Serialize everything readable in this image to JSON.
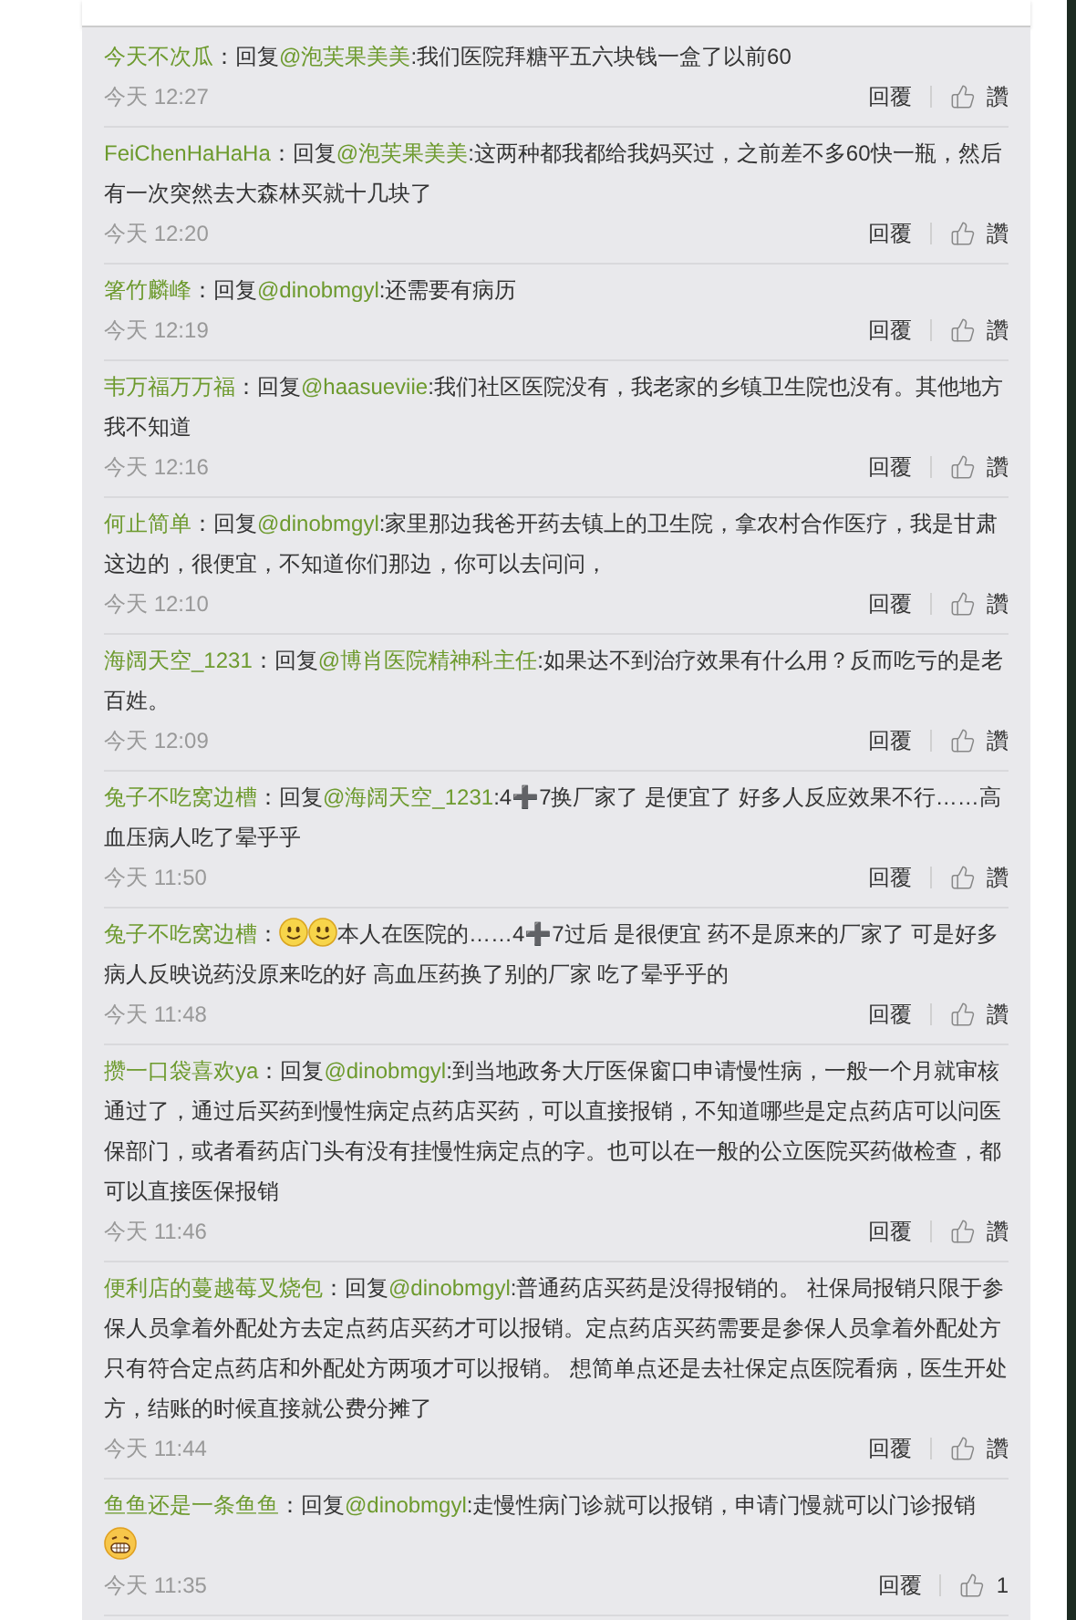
{
  "comments": [
    {
      "user": "今天不次瓜",
      "separator": "：",
      "parts": [
        {
          "kind": "text",
          "text": "回复"
        },
        {
          "kind": "mention",
          "text": "@泡芙果美美"
        },
        {
          "kind": "text",
          "text": ":我们医院拜糖平五六块钱一盒了以前60"
        }
      ],
      "time": "今天 12:27",
      "reply": "回覆",
      "like": "讚"
    },
    {
      "user": "FeiChenHaHaHa",
      "separator": "：",
      "parts": [
        {
          "kind": "text",
          "text": "回复"
        },
        {
          "kind": "mention",
          "text": "@泡芙果美美"
        },
        {
          "kind": "text",
          "text": ":这两种都我都给我妈买过，之前差不多60快一瓶，然后有一次突然去大森林买就十几块了"
        }
      ],
      "time": "今天 12:20",
      "reply": "回覆",
      "like": "讚"
    },
    {
      "user": "箸竹麟峰",
      "separator": "：",
      "parts": [
        {
          "kind": "text",
          "text": "回复"
        },
        {
          "kind": "mention",
          "text": "@dinobmgyl"
        },
        {
          "kind": "text",
          "text": ":还需要有病历"
        }
      ],
      "time": "今天 12:19",
      "reply": "回覆",
      "like": "讚"
    },
    {
      "user": "韦万福万万福",
      "separator": "：",
      "parts": [
        {
          "kind": "text",
          "text": "回复"
        },
        {
          "kind": "mention",
          "text": "@haasueviie"
        },
        {
          "kind": "text",
          "text": ":我们社区医院没有，我老家的乡镇卫生院也没有。其他地方我不知道"
        }
      ],
      "time": "今天 12:16",
      "reply": "回覆",
      "like": "讚"
    },
    {
      "user": "何止简单",
      "separator": "：",
      "parts": [
        {
          "kind": "text",
          "text": "回复"
        },
        {
          "kind": "mention",
          "text": "@dinobmgyl"
        },
        {
          "kind": "text",
          "text": ":家里那边我爸开药去镇上的卫生院，拿农村合作医疗，我是甘肃这边的，很便宜，不知道你们那边，你可以去问问，"
        }
      ],
      "time": "今天 12:10",
      "reply": "回覆",
      "like": "讚"
    },
    {
      "user": "海阔天空_1231",
      "separator": "：",
      "parts": [
        {
          "kind": "text",
          "text": "回复"
        },
        {
          "kind": "mention",
          "text": "@博肖医院精神科主任"
        },
        {
          "kind": "text",
          "text": ":如果达不到治疗效果有什么用？反而吃亏的是老百姓。"
        }
      ],
      "time": "今天 12:09",
      "reply": "回覆",
      "like": "讚"
    },
    {
      "user": "兔子不吃窝边槽",
      "separator": "：",
      "parts": [
        {
          "kind": "text",
          "text": "回复"
        },
        {
          "kind": "mention",
          "text": "@海阔天空_1231"
        },
        {
          "kind": "text",
          "text": ":4➕7换厂家了 是便宜了 好多人反应效果不行……高血压病人吃了晕乎乎"
        }
      ],
      "time": "今天 11:50",
      "reply": "回覆",
      "like": "讚"
    },
    {
      "user": "兔子不吃窝边槽",
      "separator": "：",
      "parts": [
        {
          "kind": "smile"
        },
        {
          "kind": "smile"
        },
        {
          "kind": "text",
          "text": "本人在医院的……4➕7过后 是很便宜 药不是原来的厂家了 可是好多病人反映说药没原来吃的好 高血压药换了别的厂家 吃了晕乎乎的"
        }
      ],
      "time": "今天 11:48",
      "reply": "回覆",
      "like": "讚"
    },
    {
      "user": "攒一口袋喜欢ya",
      "separator": "：",
      "parts": [
        {
          "kind": "text",
          "text": "回复"
        },
        {
          "kind": "mention",
          "text": "@dinobmgyl"
        },
        {
          "kind": "text",
          "text": ":到当地政务大厅医保窗口申请慢性病，一般一个月就审核通过了，通过后买药到慢性病定点药店买药，可以直接报销，不知道哪些是定点药店可以问医保部门，或者看药店门头有没有挂慢性病定点的字。也可以在一般的公立医院买药做检查，都可以直接医保报销"
        }
      ],
      "time": "今天 11:46",
      "reply": "回覆",
      "like": "讚"
    },
    {
      "user": "便利店的蔓越莓叉烧包",
      "separator": "：",
      "parts": [
        {
          "kind": "text",
          "text": "回复"
        },
        {
          "kind": "mention",
          "text": "@dinobmgyl"
        },
        {
          "kind": "text",
          "text": ":普通药店买药是没得报销的。 社保局报销只限于参保人员拿着外配处方去定点药店买药才可以报销。定点药店买药需要是参保人员拿着外配处方只有符合定点药店和外配处方两项才可以报销。 想简单点还是去社保定点医院看病，医生开处方，结账的时候直接就公费分摊了"
        }
      ],
      "time": "今天 11:44",
      "reply": "回覆",
      "like": "讚"
    },
    {
      "user": "鱼鱼还是一条鱼鱼",
      "separator": "：",
      "parts": [
        {
          "kind": "text",
          "text": "回复"
        },
        {
          "kind": "mention",
          "text": "@dinobmgyl"
        },
        {
          "kind": "text",
          "text": ":走慢性病门诊就可以报销，申请门慢就可以门诊报销"
        },
        {
          "kind": "grin"
        }
      ],
      "time": "今天 11:35",
      "reply": "回覆",
      "like": "1"
    }
  ]
}
